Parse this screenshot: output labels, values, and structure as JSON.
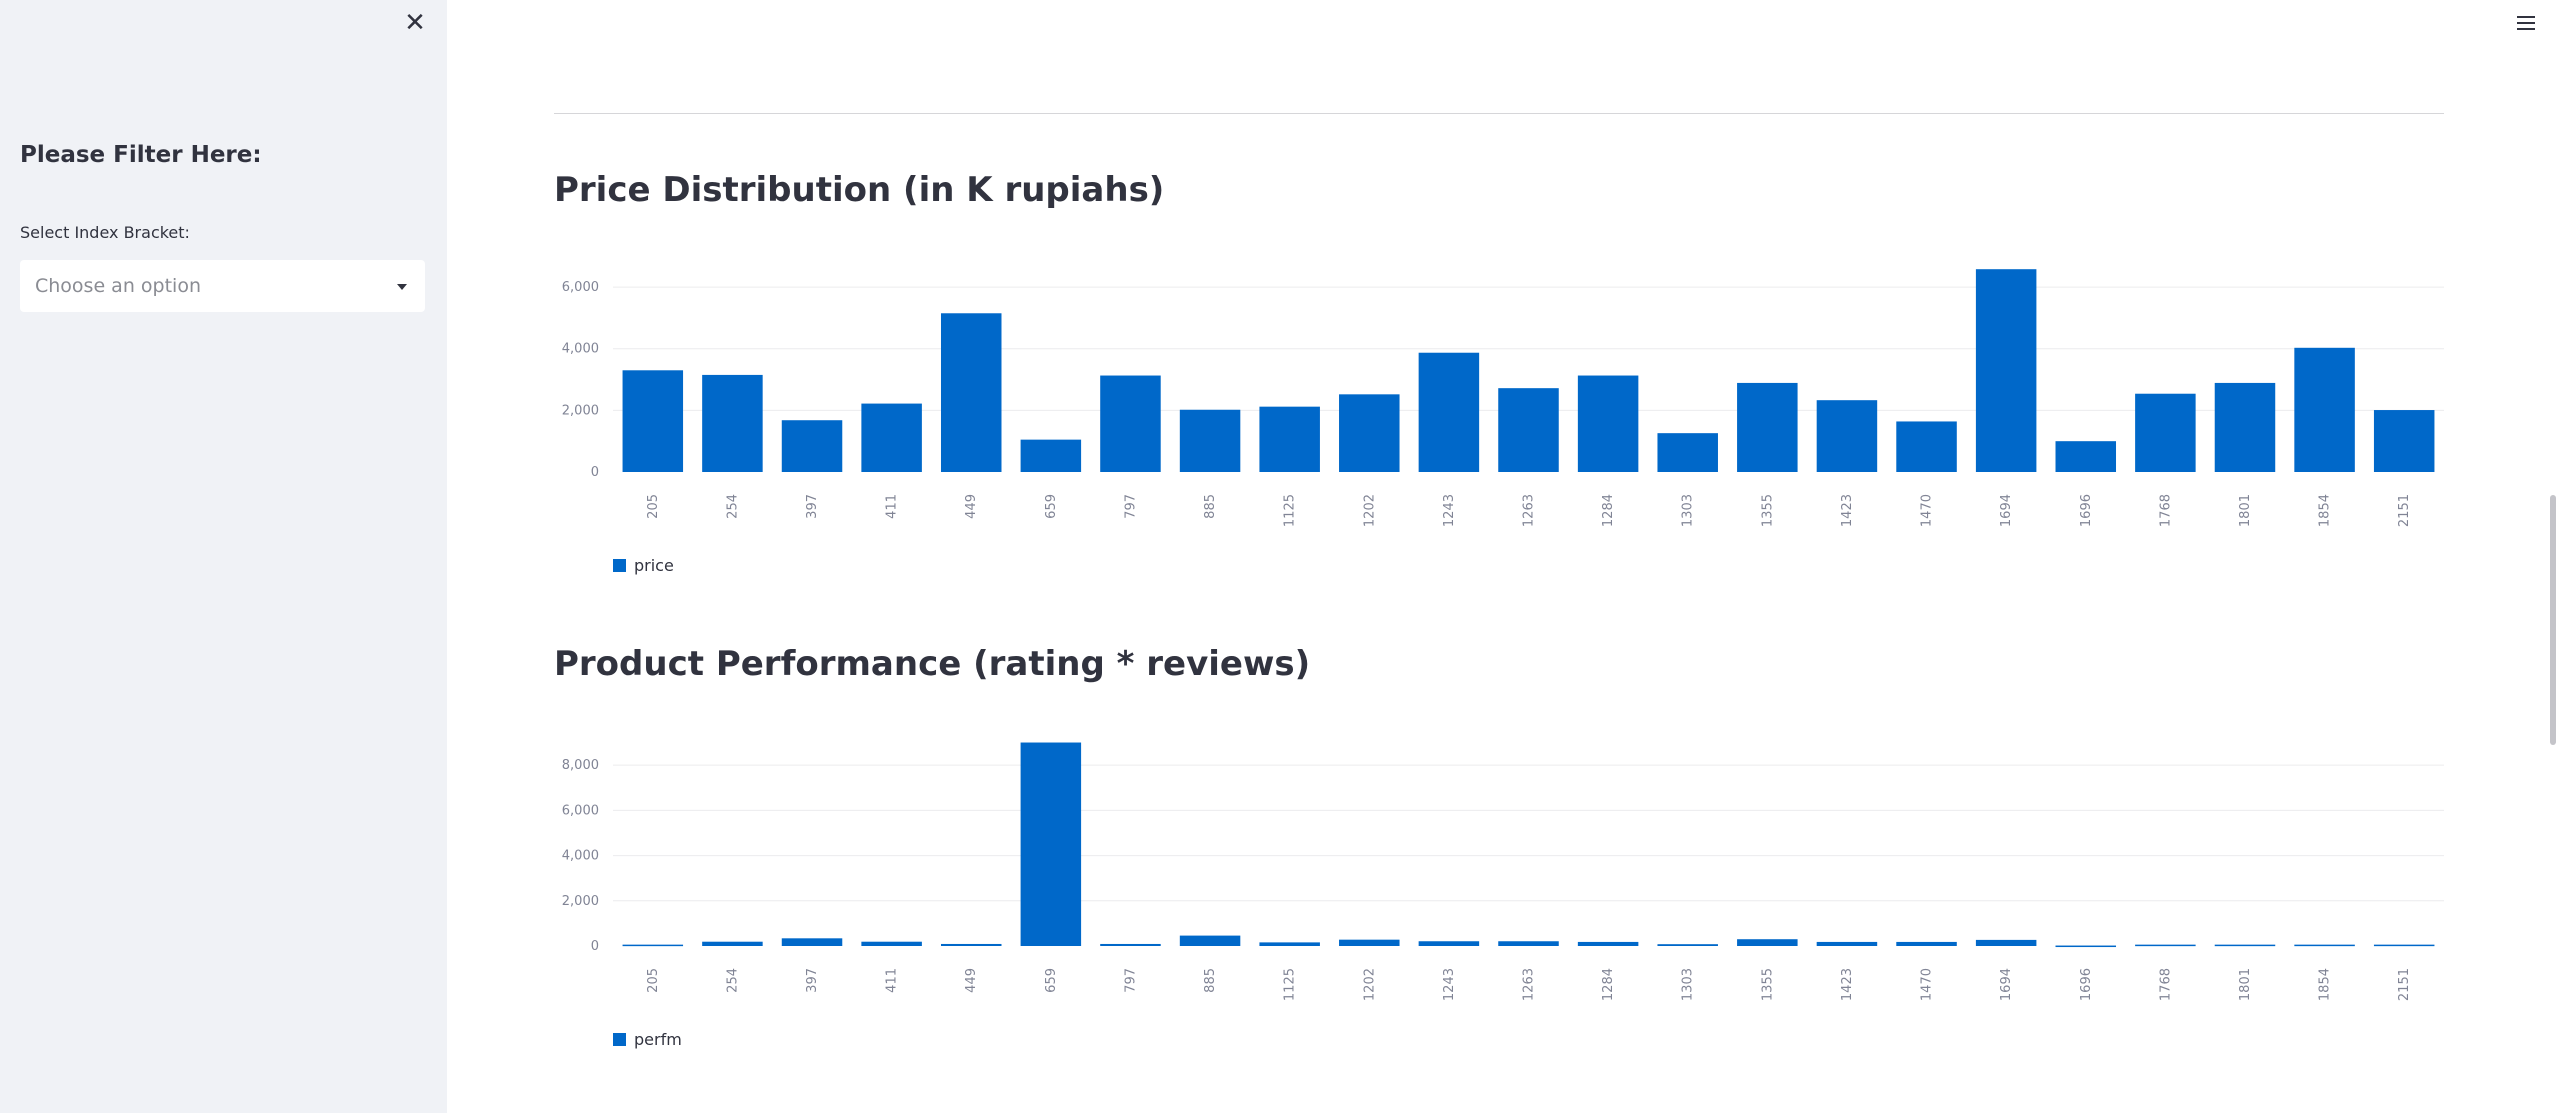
{
  "sidebar": {
    "close_icon": "close-icon",
    "heading": "Please Filter Here:",
    "select_label": "Select Index Bracket:",
    "select_placeholder": "Choose an option",
    "select_icon": "chevron-down-icon"
  },
  "header": {
    "menu_icon": "hamburger-menu-icon"
  },
  "colors": {
    "bar": "#0068C9",
    "sidebar_bg": "#F0F2F6",
    "text": "#31333F"
  },
  "chart_data": [
    {
      "type": "bar",
      "title": "Price Distribution (in K rupiahs)",
      "categories": [
        "205",
        "254",
        "397",
        "411",
        "449",
        "659",
        "797",
        "885",
        "1125",
        "1202",
        "1243",
        "1263",
        "1284",
        "1303",
        "1355",
        "1423",
        "1470",
        "1694",
        "1696",
        "1768",
        "1801",
        "1854",
        "2151"
      ],
      "series": [
        {
          "name": "price",
          "values": [
            3300,
            3150,
            1680,
            2220,
            5150,
            1050,
            3130,
            2020,
            2120,
            2520,
            3870,
            2720,
            3130,
            1260,
            2890,
            2330,
            1640,
            6580,
            1000,
            2540,
            2890,
            4030,
            2010
          ]
        }
      ],
      "ylim": [
        0,
        6700
      ],
      "yticks": [
        0,
        2000,
        4000,
        6000
      ],
      "ytick_labels": [
        "0",
        "2,000",
        "4,000",
        "6,000"
      ],
      "grid": true,
      "legend": "bottom-left"
    },
    {
      "type": "bar",
      "title": "Product Performance (rating * reviews)",
      "categories": [
        "205",
        "254",
        "397",
        "411",
        "449",
        "659",
        "797",
        "885",
        "1125",
        "1202",
        "1243",
        "1263",
        "1284",
        "1303",
        "1355",
        "1423",
        "1470",
        "1694",
        "1696",
        "1768",
        "1801",
        "1854",
        "2151"
      ],
      "series": [
        {
          "name": "perfm",
          "values": [
            60,
            190,
            340,
            190,
            90,
            9000,
            90,
            460,
            160,
            280,
            210,
            210,
            180,
            80,
            300,
            180,
            180,
            270,
            20,
            60,
            60,
            60,
            60
          ]
        }
      ],
      "ylim": [
        0,
        9200
      ],
      "yticks": [
        0,
        2000,
        4000,
        6000,
        8000
      ],
      "ytick_labels": [
        "0",
        "2,000",
        "4,000",
        "6,000",
        "8,000"
      ],
      "grid": true,
      "legend": "bottom-left"
    }
  ]
}
